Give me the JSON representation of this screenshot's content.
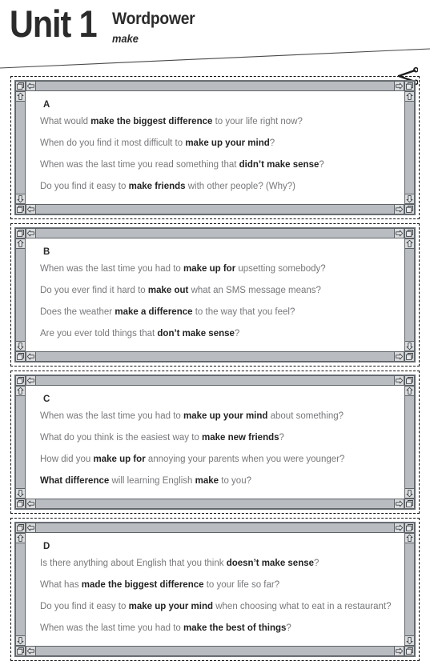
{
  "header": {
    "unit": "Unit 1",
    "section_title": "Wordpower",
    "section_subtitle": "make"
  },
  "icons": {
    "scissors": "scissors-icon",
    "resize_corner": "resize-corner-handle",
    "arrow_up": "scroll-arrow-up-icon",
    "arrow_down": "scroll-arrow-down-icon",
    "arrow_left": "scroll-arrow-left-icon",
    "arrow_right": "scroll-arrow-right-icon"
  },
  "colors": {
    "text_regular": "#77787b",
    "text_bold": "#232323",
    "heading": "#2b2b2b",
    "scrollbar_track": "#b9bdc1",
    "scrollbar_button": "#d9dadb",
    "scrollbar_border": "#5e6368",
    "card_dash_border": "#111111",
    "page_background": "#ffffff"
  },
  "cards": [
    {
      "letter": "A",
      "questions": [
        [
          {
            "text": "What would ",
            "bold": false
          },
          {
            "text": "make the biggest difference",
            "bold": true
          },
          {
            "text": " to your life right now?",
            "bold": false
          }
        ],
        [
          {
            "text": "When do you find it most difficult to ",
            "bold": false
          },
          {
            "text": "make up your mind",
            "bold": true
          },
          {
            "text": "?",
            "bold": false
          }
        ],
        [
          {
            "text": "When was the last time you read something that ",
            "bold": false
          },
          {
            "text": "didn’t make sense",
            "bold": true
          },
          {
            "text": "?",
            "bold": false
          }
        ],
        [
          {
            "text": "Do you find it easy to ",
            "bold": false
          },
          {
            "text": "make friends",
            "bold": true
          },
          {
            "text": " with other people? (Why?)",
            "bold": false
          }
        ]
      ]
    },
    {
      "letter": "B",
      "questions": [
        [
          {
            "text": "When was the last time you had to ",
            "bold": false
          },
          {
            "text": "make up for",
            "bold": true
          },
          {
            "text": " upsetting somebody?",
            "bold": false
          }
        ],
        [
          {
            "text": "Do you ever find it hard to ",
            "bold": false
          },
          {
            "text": "make out",
            "bold": true
          },
          {
            "text": " what an SMS message means?",
            "bold": false
          }
        ],
        [
          {
            "text": "Does the weather ",
            "bold": false
          },
          {
            "text": "make a difference",
            "bold": true
          },
          {
            "text": " to the way that you feel?",
            "bold": false
          }
        ],
        [
          {
            "text": "Are you ever told things that ",
            "bold": false
          },
          {
            "text": "don’t make sense",
            "bold": true
          },
          {
            "text": "?",
            "bold": false
          }
        ]
      ]
    },
    {
      "letter": "C",
      "questions": [
        [
          {
            "text": "When was the last time you had to ",
            "bold": false
          },
          {
            "text": "make up your mind",
            "bold": true
          },
          {
            "text": " about something?",
            "bold": false
          }
        ],
        [
          {
            "text": "What do you think is the easiest way to ",
            "bold": false
          },
          {
            "text": "make new friends",
            "bold": true
          },
          {
            "text": "?",
            "bold": false
          }
        ],
        [
          {
            "text": "How did you ",
            "bold": false
          },
          {
            "text": "make up for",
            "bold": true
          },
          {
            "text": " annoying your parents when you were younger?",
            "bold": false
          }
        ],
        [
          {
            "text": "What difference",
            "bold": true
          },
          {
            "text": " will learning English ",
            "bold": false
          },
          {
            "text": "make",
            "bold": true
          },
          {
            "text": " to you?",
            "bold": false
          }
        ]
      ]
    },
    {
      "letter": "D",
      "questions": [
        [
          {
            "text": "Is there anything about English that you think ",
            "bold": false
          },
          {
            "text": "doesn’t make sense",
            "bold": true
          },
          {
            "text": "?",
            "bold": false
          }
        ],
        [
          {
            "text": "What has ",
            "bold": false
          },
          {
            "text": "made the biggest difference",
            "bold": true
          },
          {
            "text": " to your life so far?",
            "bold": false
          }
        ],
        [
          {
            "text": "Do you find it easy to ",
            "bold": false
          },
          {
            "text": "make up your mind",
            "bold": true
          },
          {
            "text": " when choosing what to eat in a restaurant?",
            "bold": false
          }
        ],
        [
          {
            "text": "When was the last time you had to ",
            "bold": false
          },
          {
            "text": "make the best of things",
            "bold": true
          },
          {
            "text": "?",
            "bold": false
          }
        ]
      ]
    }
  ]
}
